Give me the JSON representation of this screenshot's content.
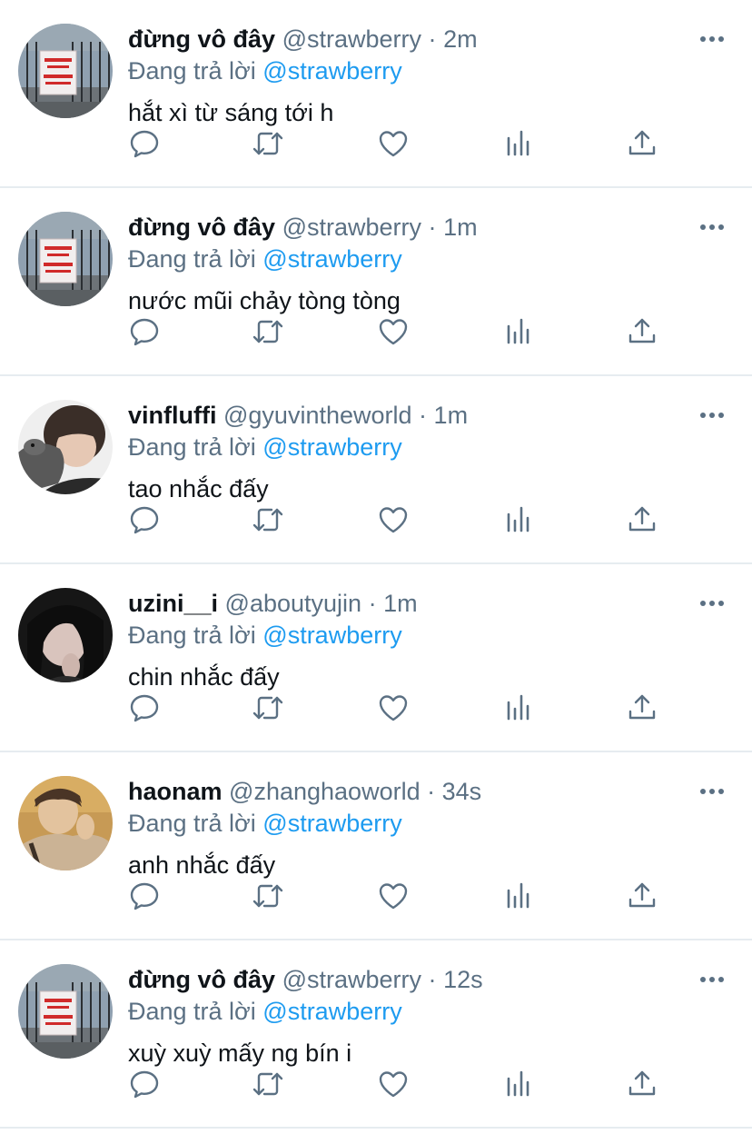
{
  "reply_prefix": "Đang trả lời",
  "colors": {
    "text": "#0f1419",
    "secondary": "#5b7083",
    "accent": "#1d9bf0",
    "divider": "#e6ecf0",
    "background": "#ffffff"
  },
  "action_icons": [
    "reply-icon",
    "retweet-icon",
    "like-icon",
    "analytics-icon",
    "share-icon"
  ],
  "tweets": [
    {
      "name": "đừng vô đây",
      "handle": "@strawberry",
      "separator": "·",
      "time": "2m",
      "reply_to": "@strawberry",
      "text": "hắt xì từ sáng tới h",
      "avatar": "sign-photo"
    },
    {
      "name": "đừng vô đây",
      "handle": "@strawberry",
      "separator": "·",
      "time": "1m",
      "reply_to": "@strawberry",
      "text": "nước mũi chảy tòng tòng",
      "avatar": "sign-photo"
    },
    {
      "name": "vinfluffi",
      "handle": "@gyuvintheworld",
      "separator": "·",
      "time": "1m",
      "reply_to": "@strawberry",
      "text": "tao nhắc đấy",
      "avatar": "person-with-dog-photo"
    },
    {
      "name": "uzini__i",
      "handle": "@aboutyujin",
      "separator": "·",
      "time": "1m",
      "reply_to": "@strawberry",
      "text": "chin nhắc đấy",
      "avatar": "dark-portrait-photo"
    },
    {
      "name": "haonam",
      "handle": "@zhanghaoworld",
      "separator": "·",
      "time": "34s",
      "reply_to": "@strawberry",
      "text": "anh nhắc đấy",
      "avatar": "warm-portrait-photo"
    },
    {
      "name": "đừng vô đây",
      "handle": "@strawberry",
      "separator": "·",
      "time": "12s",
      "reply_to": "@strawberry",
      "text": "xuỳ xuỳ mấy ng bín i",
      "avatar": "sign-photo"
    }
  ]
}
